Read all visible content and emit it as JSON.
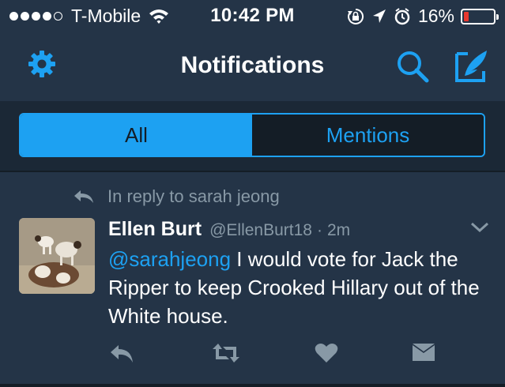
{
  "status_bar": {
    "carrier": "T-Mobile",
    "time": "10:42 PM",
    "battery_percent": "16%",
    "battery_level": 0.16,
    "signal_bars_filled": 4,
    "signal_bars_total": 5,
    "icons": [
      "wifi-icon",
      "rotation-lock-icon",
      "location-arrow-icon",
      "alarm-icon",
      "battery-icon"
    ]
  },
  "nav": {
    "title": "Notifications",
    "left_icon": "gear-icon",
    "right_icons": [
      "search-icon",
      "compose-tweet-icon"
    ]
  },
  "tabs": [
    {
      "label": "All",
      "active": true
    },
    {
      "label": "Mentions",
      "active": false
    }
  ],
  "tweet": {
    "reply_context": "In reply to sarah jeong",
    "author_name": "Ellen Burt",
    "author_handle": "@EllenBurt18",
    "separator": "·",
    "age": "2m",
    "mention": "@sarahjeong",
    "text": " I would vote for Jack the Ripper to keep Crooked Hillary out of the White house.",
    "actions": [
      "reply-icon",
      "retweet-icon",
      "like-icon",
      "direct-message-icon"
    ]
  },
  "colors": {
    "accent": "#1da1f2",
    "header_bg": "#243447",
    "page_bg": "#1b2836",
    "muted_text": "#8899a6",
    "battery_low": "#e8382f"
  }
}
